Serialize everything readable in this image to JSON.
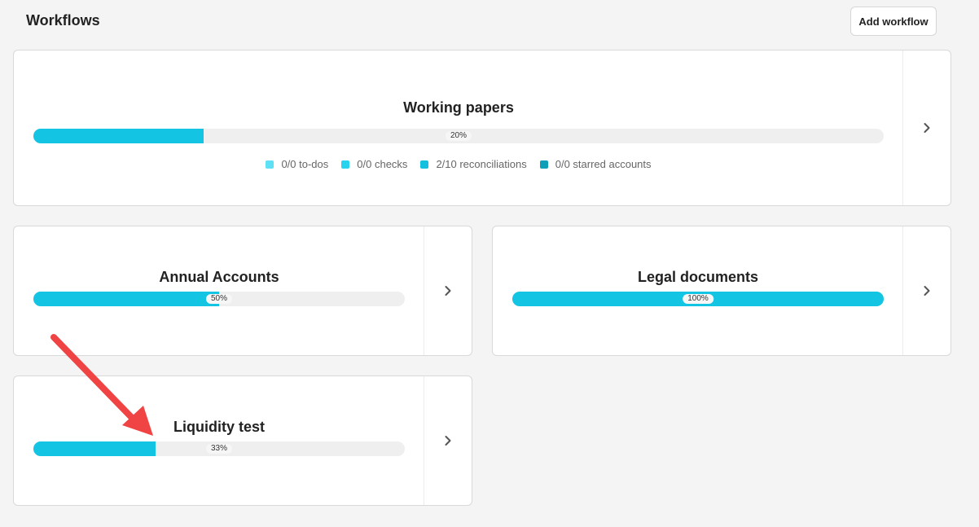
{
  "header": {
    "title": "Workflows",
    "add_button": "Add workflow"
  },
  "colors": {
    "progress_fill": "#13c4e3",
    "progress_track": "#efefef",
    "legend_todos": "#5ee0f5",
    "legend_checks": "#27d3ee",
    "legend_reconciliations": "#13c0de",
    "legend_starred": "#0e9fb8",
    "annotation_arrow": "#f04444"
  },
  "workflows": {
    "working_papers": {
      "title": "Working papers",
      "progress": 20,
      "progress_label": "20%",
      "legend": [
        {
          "label": "0/0 to-dos",
          "color": "#5ee0f5"
        },
        {
          "label": "0/0 checks",
          "color": "#27d3ee"
        },
        {
          "label": "2/10 reconciliations",
          "color": "#13c0de"
        },
        {
          "label": "0/0 starred accounts",
          "color": "#0e9fb8"
        }
      ]
    },
    "annual_accounts": {
      "title": "Annual Accounts",
      "progress": 50,
      "progress_label": "50%"
    },
    "legal_documents": {
      "title": "Legal documents",
      "progress": 100,
      "progress_label": "100%"
    },
    "liquidity_test": {
      "title": "Liquidity test",
      "progress": 33,
      "progress_label": "33%"
    }
  },
  "icons": {
    "card_arrow": "chevron-right-icon",
    "annotation": "red-arrow-annotation"
  }
}
